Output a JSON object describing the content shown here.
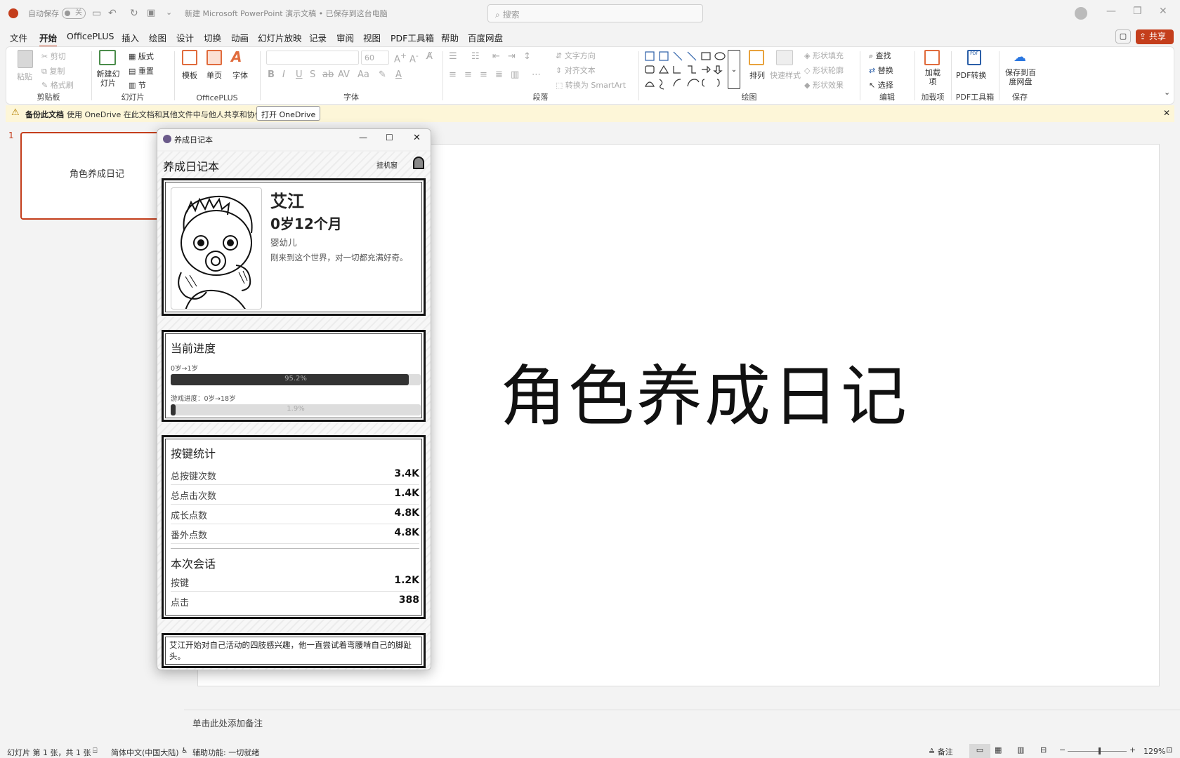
{
  "titlebar": {
    "autosave_label": "自动保存",
    "autosave_state": "关",
    "filename": "新建 Microsoft PowerPoint 演示文稿 • 已保存到这台电脑",
    "search_placeholder": "搜索"
  },
  "menu": {
    "items": [
      "文件",
      "开始",
      "OfficePLUS",
      "插入",
      "绘图",
      "设计",
      "切换",
      "动画",
      "幻灯片放映",
      "记录",
      "审阅",
      "视图",
      "PDF工具箱",
      "帮助",
      "百度网盘"
    ],
    "active": "开始",
    "share_label": "共享"
  },
  "ribbon": {
    "clipboard": {
      "label": "剪贴板",
      "paste": "粘贴",
      "cut": "剪切",
      "copy": "复制",
      "format_painter": "格式刷"
    },
    "slides": {
      "label": "幻灯片",
      "new_slide": "新建幻灯片",
      "layout": "版式",
      "reset": "重置",
      "section": "节"
    },
    "officeplus": {
      "label": "OfficePLUS",
      "template": "模板",
      "single_page": "单页",
      "font": "字体"
    },
    "font": {
      "label": "字体",
      "size": "60"
    },
    "paragraph": {
      "label": "段落",
      "text_direction": "文字方向",
      "align_text": "对齐文本",
      "convert_smartart": "转换为 SmartArt"
    },
    "drawing": {
      "label": "绘图",
      "arrange": "排列",
      "quick_styles": "快速样式",
      "shape_fill": "形状填充",
      "shape_outline": "形状轮廓",
      "shape_effects": "形状效果"
    },
    "editing": {
      "label": "编辑",
      "find": "查找",
      "replace": "替换",
      "select": "选择"
    },
    "addins": {
      "label": "加载项",
      "addins": "加载项"
    },
    "pdf": {
      "label": "PDF工具箱",
      "convert": "PDF转换"
    },
    "save": {
      "label": "保存",
      "save_baidu": "保存到百度网盘"
    }
  },
  "banner": {
    "title": "备份此文档",
    "message": "使用 OneDrive 在此文档和其他文件中与他人共享和协作。",
    "button": "打开 OneDrive"
  },
  "thumbnails": [
    {
      "number": "1",
      "text": "角色养成日记"
    }
  ],
  "slide": {
    "title": "角色养成日记"
  },
  "notes_placeholder": "单击此处添加备注",
  "statusbar": {
    "slide_info": "幻灯片 第 1 张，共 1 张",
    "language": "简体中文(中国大陆)",
    "accessibility": "辅助功能: 一切就绪",
    "notes": "备注",
    "zoom": "129%"
  },
  "app": {
    "window_title": "养成日记本",
    "header_title": "养成日记本",
    "header_link": "挂机窗",
    "character": {
      "name": "艾江",
      "age": "0岁12个月",
      "stage": "婴幼儿",
      "description": "刚来到这个世界，对一切都充满好奇。"
    },
    "progress": {
      "title": "当前进度",
      "stage_label": "0岁→1岁",
      "stage_value": 0.952,
      "stage_text": "95.2%",
      "game_label": "游戏进度：0岁→18岁",
      "game_value": 0.019,
      "game_text": "1.9%"
    },
    "stats": {
      "title": "按键统计",
      "rows": [
        {
          "label": "总按键次数",
          "value": "3.4K"
        },
        {
          "label": "总点击次数",
          "value": "1.4K"
        },
        {
          "label": "成长点数",
          "value": "4.8K"
        },
        {
          "label": "番外点数",
          "value": "4.8K"
        }
      ],
      "session_title": "本次会话",
      "session_rows": [
        {
          "label": "按键",
          "value": "1.2K"
        },
        {
          "label": "点击",
          "value": "388"
        }
      ]
    },
    "log": "艾江开始对自己活动的四肢感兴趣，他一直尝试着弯腰啃自己的脚趾头。"
  },
  "colors": {
    "accent": "#c43e1c",
    "banner_bg": "#fdf6d8",
    "progress_fill": "#333333"
  }
}
